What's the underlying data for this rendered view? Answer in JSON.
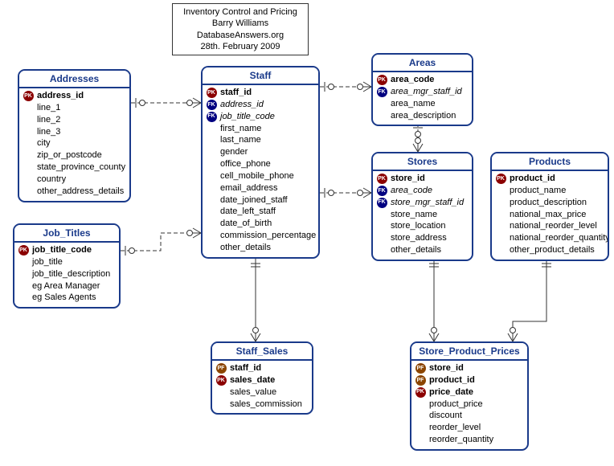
{
  "title": {
    "line1": "Inventory Control and Pricing",
    "line2": "Barry Williams",
    "line3": "DatabaseAnswers.org",
    "line4": "28th. February 2009"
  },
  "entities": {
    "addresses": {
      "name": "Addresses",
      "attrs": [
        {
          "key": "PK",
          "label": "address_id",
          "bold": true
        },
        {
          "key": "",
          "label": "line_1"
        },
        {
          "key": "",
          "label": "line_2"
        },
        {
          "key": "",
          "label": "line_3"
        },
        {
          "key": "",
          "label": "city"
        },
        {
          "key": "",
          "label": "zip_or_postcode"
        },
        {
          "key": "",
          "label": "state_province_county"
        },
        {
          "key": "",
          "label": "country"
        },
        {
          "key": "",
          "label": "other_address_details"
        }
      ]
    },
    "job_titles": {
      "name": "Job_Titles",
      "attrs": [
        {
          "key": "PK",
          "label": "job_title_code",
          "bold": true
        },
        {
          "key": "",
          "label": "job_title"
        },
        {
          "key": "",
          "label": "job_title_description"
        },
        {
          "key": "",
          "label": "eg Area Manager"
        },
        {
          "key": "",
          "label": "eg Sales Agents"
        }
      ]
    },
    "staff": {
      "name": "Staff",
      "attrs": [
        {
          "key": "PK",
          "label": "staff_id",
          "bold": true
        },
        {
          "key": "FK",
          "label": "address_id",
          "italic": true
        },
        {
          "key": "FK",
          "label": "job_title_code",
          "italic": true
        },
        {
          "key": "",
          "label": "first_name"
        },
        {
          "key": "",
          "label": "last_name"
        },
        {
          "key": "",
          "label": "gender"
        },
        {
          "key": "",
          "label": "office_phone"
        },
        {
          "key": "",
          "label": "cell_mobile_phone"
        },
        {
          "key": "",
          "label": "email_address"
        },
        {
          "key": "",
          "label": "date_joined_staff"
        },
        {
          "key": "",
          "label": "date_left_staff"
        },
        {
          "key": "",
          "label": "date_of_birth"
        },
        {
          "key": "",
          "label": "commission_percentage"
        },
        {
          "key": "",
          "label": "other_details"
        }
      ]
    },
    "areas": {
      "name": "Areas",
      "attrs": [
        {
          "key": "PK",
          "label": "area_code",
          "bold": true
        },
        {
          "key": "FK",
          "label": "area_mgr_staff_id",
          "italic": true
        },
        {
          "key": "",
          "label": "area_name"
        },
        {
          "key": "",
          "label": "area_description"
        }
      ]
    },
    "stores": {
      "name": "Stores",
      "attrs": [
        {
          "key": "PK",
          "label": "store_id",
          "bold": true
        },
        {
          "key": "FK",
          "label": "area_code",
          "italic": true
        },
        {
          "key": "FK",
          "label": "store_mgr_staff_id",
          "italic": true
        },
        {
          "key": "",
          "label": "store_name"
        },
        {
          "key": "",
          "label": "store_location"
        },
        {
          "key": "",
          "label": "store_address"
        },
        {
          "key": "",
          "label": "other_details"
        }
      ]
    },
    "products": {
      "name": "Products",
      "attrs": [
        {
          "key": "PK",
          "label": "product_id",
          "bold": true
        },
        {
          "key": "",
          "label": "product_name"
        },
        {
          "key": "",
          "label": "product_description"
        },
        {
          "key": "",
          "label": "national_max_price"
        },
        {
          "key": "",
          "label": "national_reorder_level"
        },
        {
          "key": "",
          "label": "national_reorder_quantity"
        },
        {
          "key": "",
          "label": "other_product_details"
        }
      ]
    },
    "staff_sales": {
      "name": "Staff_Sales",
      "attrs": [
        {
          "key": "PF",
          "label": "staff_id",
          "bold": true
        },
        {
          "key": "PK",
          "label": "sales_date",
          "bold": true
        },
        {
          "key": "",
          "label": "sales_value"
        },
        {
          "key": "",
          "label": "sales_commission"
        }
      ]
    },
    "store_product_prices": {
      "name": "Store_Product_Prices",
      "attrs": [
        {
          "key": "PF",
          "label": "store_id",
          "bold": true
        },
        {
          "key": "PF",
          "label": "product_id",
          "bold": true
        },
        {
          "key": "PK",
          "label": "price_date",
          "bold": true
        },
        {
          "key": "",
          "label": "product_price"
        },
        {
          "key": "",
          "label": "discount"
        },
        {
          "key": "",
          "label": "reorder_level"
        },
        {
          "key": "",
          "label": "reorder_quantity"
        }
      ]
    }
  }
}
